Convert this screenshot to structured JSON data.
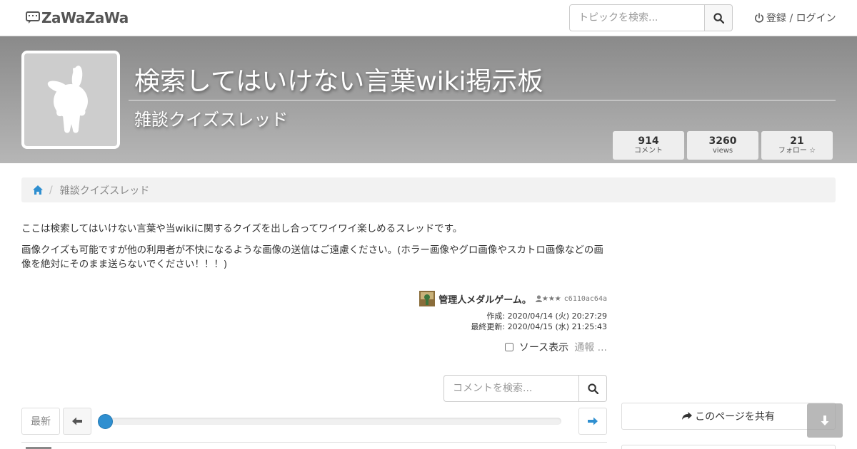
{
  "app": {
    "logo_text": "ZaWaZaWa"
  },
  "navbar": {
    "search_placeholder": "トピックを検索...",
    "search_icon": "search-icon",
    "login_icon": "power-icon",
    "login_label": "登録 / ログイン"
  },
  "header": {
    "title": "検索してはいけない言葉wiki掲示板",
    "subtitle": "雑談クイズスレッド",
    "stats": [
      {
        "value": "914",
        "label": "コメント"
      },
      {
        "value": "3260",
        "label": "views"
      },
      {
        "value": "21",
        "label": "フォロー ☆"
      }
    ]
  },
  "breadcrumb": {
    "home_icon": "home-icon",
    "separator": "/",
    "current": "雑談クイズスレッド"
  },
  "description": {
    "lines": [
      "ここは検索してはいけない言葉や当wikiに関するクイズを出し合ってワイワイ楽しめるスレッドです。",
      "画像クイズも可能ですが他の利用者が不快になるような画像の送信はご遠慮ください。(ホラー画像やグロ画像やスカトロ画像などの画像を絶対にそのまま送らないでください！！！)"
    ]
  },
  "author": {
    "name": "管理人メダルゲーム。",
    "rank": "★★★",
    "id": "c6110ac64a",
    "created": "作成: 2020/04/14 (火) 20:27:29",
    "updated": "最終更新: 2020/04/15 (水) 21:25:43"
  },
  "thread_actions": {
    "source_label": "ソース表示",
    "report_label": "通報 ..."
  },
  "comment_search": {
    "placeholder": "コメントを検索..."
  },
  "pager": {
    "latest_label": "最新",
    "prev_icon": "arrow-left-icon",
    "next_icon": "arrow-right-icon",
    "position": 0
  },
  "sidebar": {
    "share_label": "このページを共有",
    "share_icon": "share-icon",
    "scroll_icon": "arrow-down-icon"
  },
  "colors": {
    "accent": "#2f8fd0",
    "banner_top": "#8a8a8a",
    "banner_bottom": "#b6b6b6"
  }
}
